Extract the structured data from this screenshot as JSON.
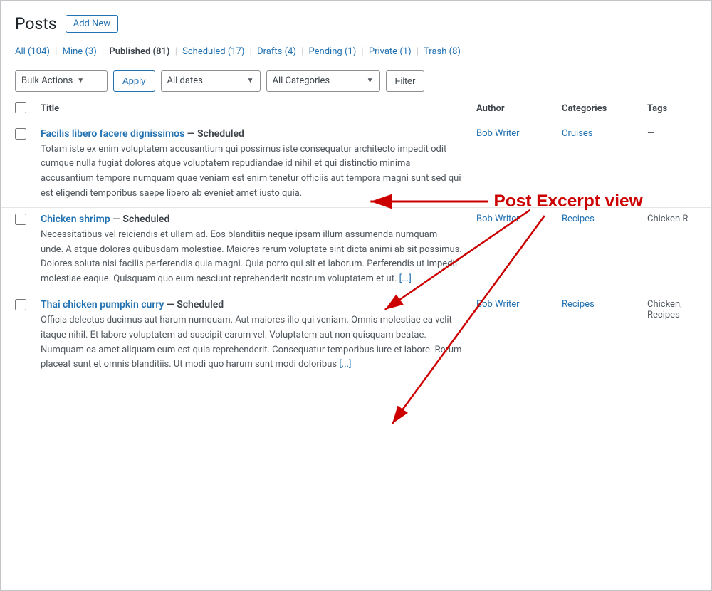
{
  "page": {
    "title": "Posts",
    "add_new_label": "Add New"
  },
  "filters": {
    "all_label": "All",
    "all_count": "(104)",
    "mine_label": "Mine",
    "mine_count": "(3)",
    "published_label": "Published",
    "published_count": "(81)",
    "scheduled_label": "Scheduled",
    "scheduled_count": "(17)",
    "drafts_label": "Drafts",
    "drafts_count": "(4)",
    "pending_label": "Pending",
    "pending_count": "(1)",
    "private_label": "Private",
    "private_count": "(1)",
    "trash_label": "Trash",
    "trash_count": "(8)"
  },
  "toolbar": {
    "bulk_actions_label": "Bulk Actions",
    "apply_label": "Apply",
    "all_dates_label": "All dates",
    "all_categories_label": "All Categories",
    "filter_label": "Filter"
  },
  "table": {
    "col_title": "Title",
    "col_author": "Author",
    "col_categories": "Categories",
    "col_tags": "Tags"
  },
  "posts": [
    {
      "title": "Facilis libero facere dignissimos",
      "status": "Scheduled",
      "author": "Bob Writer",
      "categories": "Cruises",
      "tags": "—",
      "excerpt": "Totam iste ex enim voluptatem accusantium qui possimus iste consequatur architecto impedit odit cumque nulla fugiat dolores atque voluptatem repudiandae id nihil et qui distinctio minima accusantium tempore numquam quae veniam est enim tenetur officiis aut tempora magni sunt sed qui est eligendi temporibus saepe libero ab eveniet amet iusto quia."
    },
    {
      "title": "Chicken shrimp",
      "status": "Scheduled",
      "author": "Bob Writer",
      "categories": "Recipes",
      "tags": "Chicken R",
      "excerpt": "Necessitatibus vel reiciendis et ullam ad. Eos blanditiis neque ipsam illum assumenda numquam unde. A atque dolores quibusdam molestiae. Maiores rerum voluptate sint dicta animi ab sit possimus. Dolores soluta nisi facilis perferendis quia magni. Quia porro qui sit et laborum. Perferendis ut impedit molestiae eaque. Quisquam quo eum nesciunt reprehenderit nostrum voluptatem et ut.",
      "excerpt_more": "[...]"
    },
    {
      "title": "Thai chicken pumpkin curry",
      "status": "Scheduled",
      "author": "Bob Writer",
      "categories": "Recipes",
      "tags": "Chicken, Recipes",
      "excerpt": "Officia delectus ducimus aut harum numquam. Aut maiores illo qui veniam. Omnis molestiae ea velit itaque nihil. Et labore voluptatem ad suscipit earum vel. Voluptatem aut non quisquam beatae. Numquam ea amet aliquam eum est quia reprehenderit. Consequatur temporibus iure et labore. Rerum placeat sunt et omnis blanditiis. Ut modi quo harum sunt modi doloribus",
      "excerpt_more": "[...]"
    }
  ],
  "annotation": {
    "label": "Post Excerpt view"
  }
}
